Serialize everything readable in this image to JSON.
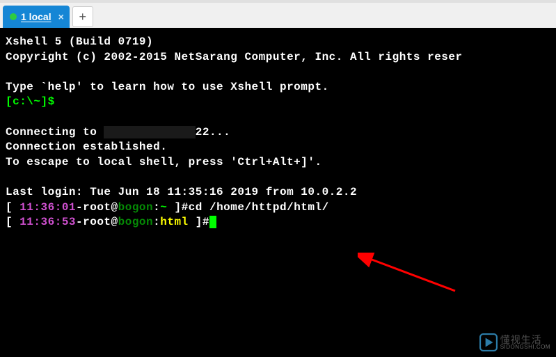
{
  "tabbar": {
    "active_tab_label": "1 local",
    "newtab_label": "+"
  },
  "terminal": {
    "line1": "Xshell 5 (Build 0719)",
    "line2": "Copyright (c) 2002-2015 NetSarang Computer, Inc. All rights reser",
    "blank": "",
    "help_line": "Type `help' to learn how to use Xshell prompt.",
    "local_prompt_bracket_open": "[c:\\~]",
    "local_prompt_dollar": "$",
    "connecting_prefix": "Connecting to ",
    "connecting_redacted": "             ",
    "connecting_suffix": "22...",
    "established": "Connection established.",
    "escape_line": "To escape to local shell, press 'Ctrl+Alt+]'.",
    "last_login": "Last login: Tue Jun 18 11:35:16 2019 from 10.0.2.2",
    "p1_bracket_open": "[ ",
    "p1_time": "11:36:01",
    "p1_user": "-root@",
    "p1_host": "bogon",
    "p1_colon": ":",
    "p1_cwd": "~",
    "p1_end": " ]#",
    "p1_cmd": "cd /home/httpd/html/",
    "p2_bracket_open": "[ ",
    "p2_time": "11:36:53",
    "p2_user": "-root@",
    "p2_host": "bogon",
    "p2_colon": ":",
    "p2_cwd": "html",
    "p2_end": " ]#"
  },
  "watermark": {
    "main": "懂视生活",
    "sub": "SIDONGSHI.COM"
  }
}
